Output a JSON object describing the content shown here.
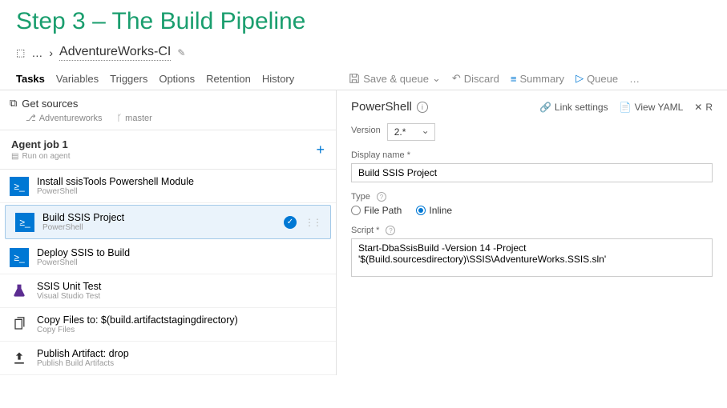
{
  "slide": {
    "title": "Step 3 – The Build Pipeline"
  },
  "breadcrumb": {
    "ellipsis": "…",
    "name": "AdventureWorks-CI"
  },
  "tabs": {
    "items": [
      "Tasks",
      "Variables",
      "Triggers",
      "Options",
      "Retention",
      "History"
    ],
    "active": 0
  },
  "toolbar": {
    "save": "Save & queue",
    "discard": "Discard",
    "summary": "Summary",
    "queue": "Queue"
  },
  "sources": {
    "heading": "Get sources",
    "repo": "Adventureworks",
    "branch": "master"
  },
  "agent": {
    "title": "Agent job 1",
    "subtitle": "Run on agent"
  },
  "tasks": [
    {
      "title": "Install ssisTools Powershell Module",
      "subtitle": "PowerShell",
      "icon": "ps",
      "selected": false
    },
    {
      "title": "Build SSIS Project",
      "subtitle": "PowerShell",
      "icon": "ps",
      "selected": true
    },
    {
      "title": "Deploy SSIS to Build",
      "subtitle": "PowerShell",
      "icon": "ps",
      "selected": false
    },
    {
      "title": "SSIS Unit Test",
      "subtitle": "Visual Studio Test",
      "icon": "flask",
      "selected": false
    },
    {
      "title": "Copy Files to: $(build.artifactstagingdirectory)",
      "subtitle": "Copy Files",
      "icon": "copy",
      "selected": false
    },
    {
      "title": "Publish Artifact: drop",
      "subtitle": "Publish Build Artifacts",
      "icon": "upload",
      "selected": false
    }
  ],
  "panel": {
    "title": "PowerShell",
    "links": {
      "link_settings": "Link settings",
      "view_yaml": "View YAML",
      "remove": "R"
    },
    "version": {
      "label": "Version",
      "value": "2.*"
    },
    "display_name": {
      "label": "Display name *",
      "value": "Build SSIS Project"
    },
    "type": {
      "label": "Type",
      "options": [
        "File Path",
        "Inline"
      ],
      "selected": 1
    },
    "script": {
      "label": "Script *",
      "value": "Start-DbaSsisBuild -Version 14 -Project '$(Build.sourcesdirectory)\\SSIS\\AdventureWorks.SSIS.sln'"
    }
  }
}
